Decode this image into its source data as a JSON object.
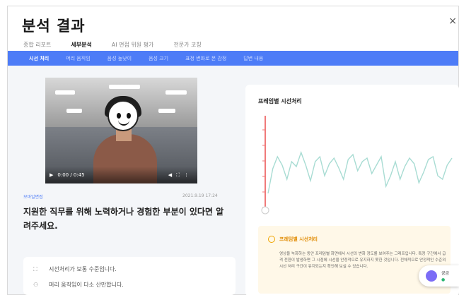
{
  "header": {
    "title": "분석 결과",
    "close_glyph": "×"
  },
  "tabs": [
    {
      "label": "종합 리포트",
      "active": false
    },
    {
      "label": "세부분석",
      "active": true
    },
    {
      "label": "AI 면접 위원 평가",
      "active": false
    },
    {
      "label": "전문가 코칭",
      "active": false
    }
  ],
  "subnav": [
    {
      "label": "시선 처리",
      "active": true
    },
    {
      "label": "머리 움직임",
      "active": false
    },
    {
      "label": "음성 높낮이",
      "active": false
    },
    {
      "label": "음성 크기",
      "active": false
    },
    {
      "label": "표정 변화로 본 감정",
      "active": false
    },
    {
      "label": "답변 내용",
      "active": false
    }
  ],
  "video": {
    "time": "0:00 / 0:45"
  },
  "question": {
    "tag": "모바일면접",
    "date": "2021.9.19 17:24",
    "text": "지원한 직무를 위해 노력하거나 경험한 부분이 있다면 알려주세요."
  },
  "feedback": [
    {
      "icon": "eye-icon",
      "text": "시선처리가 보통 수준입니다."
    },
    {
      "icon": "head-icon",
      "text": "머리 움직임이 다소 산만합니다."
    }
  ],
  "chart_data": {
    "type": "line",
    "title": "프레임별 시선처리",
    "series": [
      {
        "values": [
          0.1,
          0.45,
          0.62,
          0.5,
          0.3,
          0.55,
          0.48,
          0.68,
          0.5,
          0.28,
          0.55,
          0.62,
          0.35,
          0.52,
          0.6,
          0.46,
          0.3,
          0.58,
          0.65,
          0.42,
          0.55,
          0.6,
          0.38,
          0.5,
          0.62,
          0.2,
          0.35,
          0.55,
          0.3,
          0.48,
          0.6,
          0.52,
          0.25,
          0.4,
          0.58,
          0.62,
          0.35,
          0.3,
          0.5,
          0.6
        ]
      }
    ],
    "colors": {
      "line": "#a8dcd3",
      "marker": "#f07a7a"
    }
  },
  "info": {
    "title": "프레임별 시선처리",
    "body": "영상을 녹화하는 동안 프레임별 화면에서 시선의 변화 정도를 보여주는 그래프입니다. 특정 구간에서 급격 전환이 발생하면 그 시점에 시선을 안정적으로 유지하지 못한 것입니다. 전체적으로 안정적인 수준의 시선 처리 구간이 유지되는지 확인해 보실 수 있습니다."
  },
  "chat": {
    "label": "궁금",
    "status": "●"
  },
  "colors": {
    "accent": "#4d7cf7",
    "info_bg": "#fff8e8",
    "info_title": "#e08a00"
  }
}
